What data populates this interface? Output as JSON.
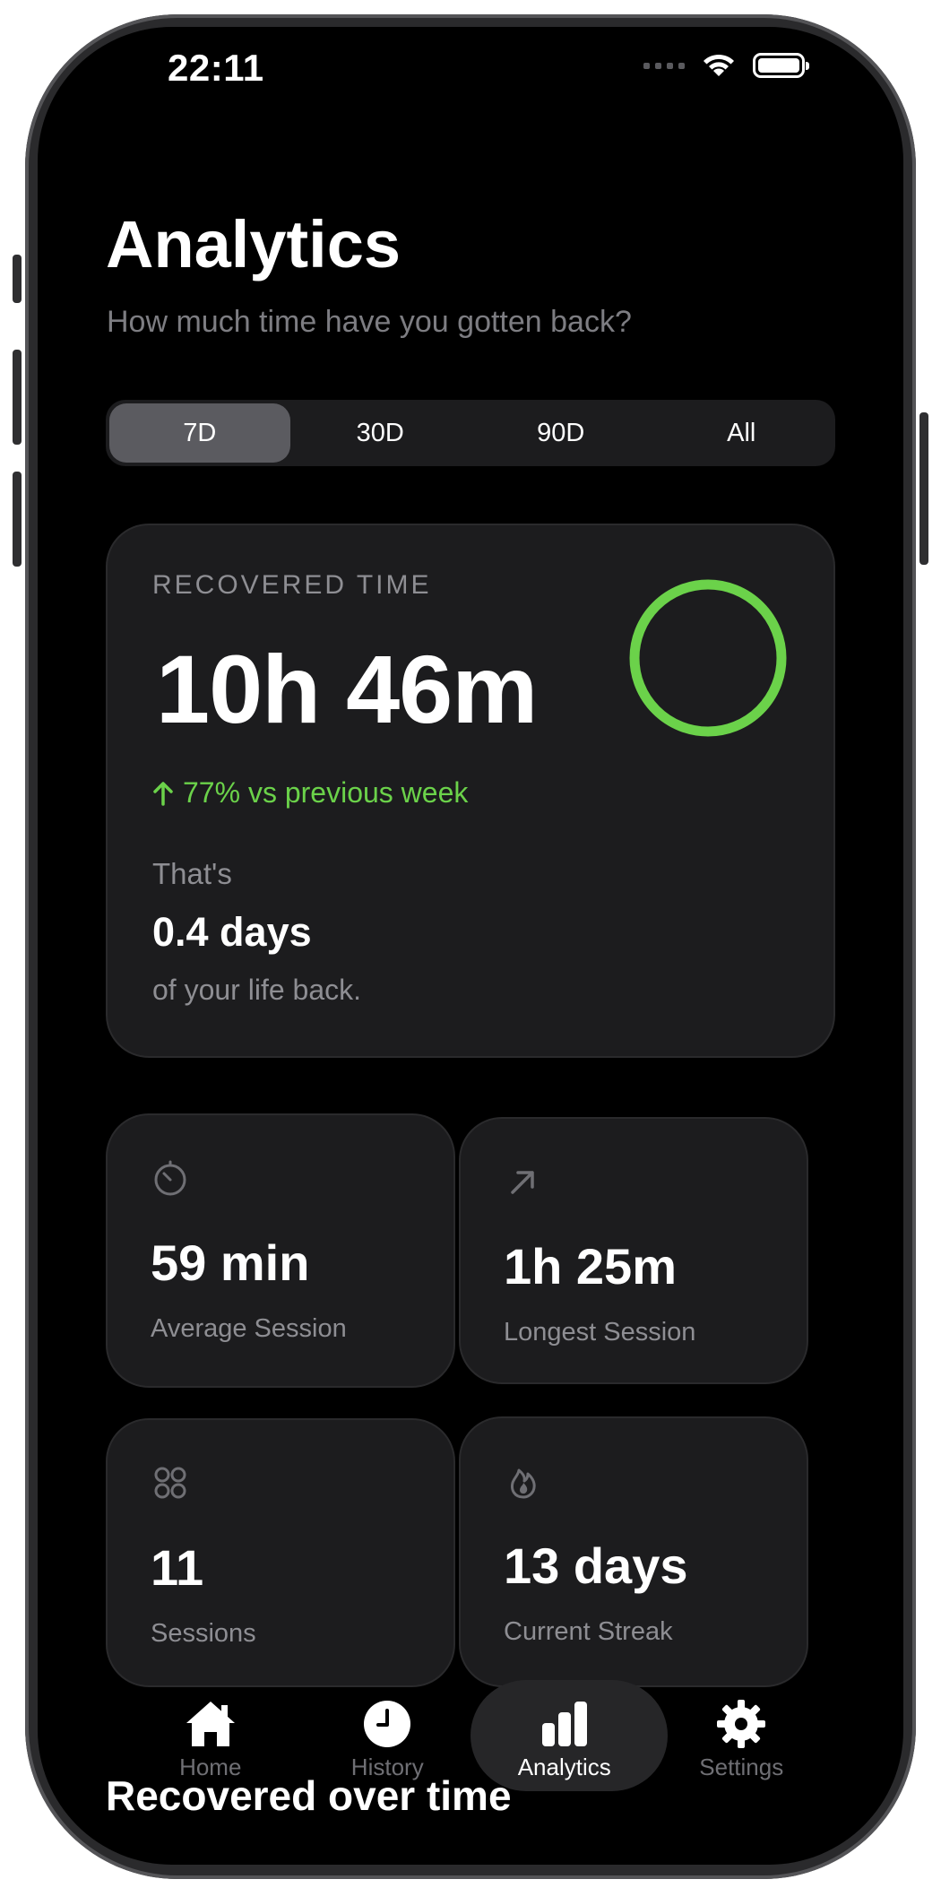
{
  "status_bar": {
    "time": "22:11"
  },
  "header": {
    "title": "Analytics",
    "subtitle": "How much time have you gotten back?"
  },
  "range_selector": {
    "options": [
      "7D",
      "30D",
      "90D",
      "All"
    ],
    "selected": "7D"
  },
  "recovered_card": {
    "eyebrow": "RECOVERED TIME",
    "value": "10h 46m",
    "trend": "77% vs previous week",
    "prefix": "That's",
    "equivalent": "0.4 days",
    "suffix": "of your life back.",
    "ring_color": "#6bd24a"
  },
  "stats": [
    {
      "value": "59 min",
      "label": "Average Session",
      "icon": "timer-icon"
    },
    {
      "value": "1h 25m",
      "label": "Longest Session",
      "icon": "arrow-up-right-icon"
    },
    {
      "value": "11",
      "label": "Sessions",
      "icon": "grid-icon"
    },
    {
      "value": "13 days",
      "label": "Current Streak",
      "icon": "flame-icon"
    }
  ],
  "tab_bar": {
    "items": [
      {
        "label": "Home",
        "icon": "house-icon"
      },
      {
        "label": "History",
        "icon": "clock-icon"
      },
      {
        "label": "Analytics",
        "icon": "chart-bar-icon"
      },
      {
        "label": "Settings",
        "icon": "gear-icon"
      }
    ],
    "active": "Analytics"
  },
  "section": {
    "heading": "Recovered over time"
  },
  "colors": {
    "accent_green": "#6bd24a",
    "card_bg": "#1c1c1e",
    "background": "#000000"
  }
}
